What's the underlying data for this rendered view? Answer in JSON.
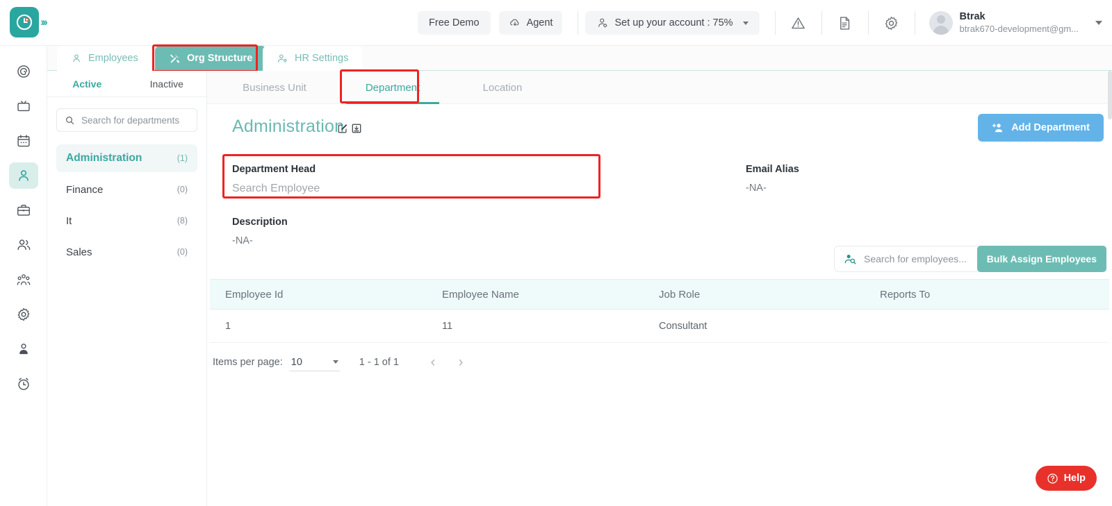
{
  "brand": {
    "logo_icon": "clock-badge-icon",
    "expand_icon": "double-chevron-right-icon",
    "accent": "#2aa6a0"
  },
  "topbar": {
    "free_demo_label": "Free Demo",
    "agent_label": "Agent",
    "agent_icon": "cloud-download-icon",
    "setup_label": "Set up your account : 75%",
    "setup_icon": "user-gear-icon",
    "warning_icon": "warning-triangle-icon",
    "document_icon": "document-icon",
    "settings_icon": "gear-icon",
    "user": {
      "name": "Btrak",
      "email": "btrak670-development@gm...",
      "avatar_icon": "user-avatar-icon"
    },
    "dropdown_icon": "chevron-down-icon"
  },
  "rail": {
    "items": [
      {
        "icon": "target-spiral-icon",
        "active": false
      },
      {
        "icon": "tv-screen-icon",
        "active": false
      },
      {
        "icon": "calendar-icon",
        "active": false
      },
      {
        "icon": "person-icon",
        "active": true
      },
      {
        "icon": "briefcase-icon",
        "active": false
      },
      {
        "icon": "two-people-icon",
        "active": false
      },
      {
        "icon": "group-people-icon",
        "active": false
      },
      {
        "icon": "gear-icon",
        "active": false
      },
      {
        "icon": "user-profile-icon",
        "active": false
      },
      {
        "icon": "alarm-clock-icon",
        "active": false
      }
    ]
  },
  "main_tabs": [
    {
      "label": "Employees",
      "icon": "person-icon",
      "selected": false
    },
    {
      "label": "Org Structure",
      "icon": "tools-icon",
      "selected": true
    },
    {
      "label": "HR Settings",
      "icon": "person-gear-icon",
      "selected": false
    }
  ],
  "left_panel": {
    "status_tabs": [
      {
        "label": "Active",
        "selected": true
      },
      {
        "label": "Inactive",
        "selected": false
      }
    ],
    "search": {
      "placeholder": "Search for departments",
      "value": "",
      "icon": "search-icon"
    },
    "departments": [
      {
        "name": "Administration",
        "count": "(1)",
        "selected": true
      },
      {
        "name": "Finance",
        "count": "(0)",
        "selected": false
      },
      {
        "name": "It",
        "count": "(8)",
        "selected": false
      },
      {
        "name": "Sales",
        "count": "(0)",
        "selected": false
      }
    ]
  },
  "sub_tabs": [
    {
      "label": "Business Unit",
      "selected": false
    },
    {
      "label": "Department",
      "selected": true
    },
    {
      "label": "Location",
      "selected": false
    }
  ],
  "detail": {
    "title": "Administration",
    "edit_icon": "edit-pencil-square-icon",
    "archive_icon": "archive-box-icon",
    "add_department_label": "Add Department",
    "add_department_icon": "add-person-icon",
    "department_head": {
      "label": "Department Head",
      "placeholder": "Search Employee",
      "value": ""
    },
    "description": {
      "label": "Description",
      "value": "-NA-"
    },
    "email_alias": {
      "label": "Email Alias",
      "value": "-NA-"
    }
  },
  "table_toolbar": {
    "search": {
      "placeholder": "Search for employees...",
      "value": "",
      "icon": "person-search-icon"
    },
    "bulk_assign_label": "Bulk Assign Employees"
  },
  "table": {
    "columns": [
      "Employee Id",
      "Employee Name",
      "Job Role",
      "Reports To"
    ],
    "rows": [
      {
        "employee_id": "1",
        "employee_name": "11",
        "job_role": "Consultant",
        "reports_to": ""
      }
    ]
  },
  "paginator": {
    "items_per_page_label": "Items per page:",
    "items_per_page_value": "10",
    "dropdown_icon": "chevron-down-icon",
    "range_label": "1 - 1 of 1",
    "prev_icon": "chevron-left-icon",
    "next_icon": "chevron-right-icon"
  },
  "help": {
    "label": "Help",
    "icon": "question-circle-icon",
    "color": "#e8312a"
  },
  "highlights": {
    "color": "#ee2222"
  }
}
